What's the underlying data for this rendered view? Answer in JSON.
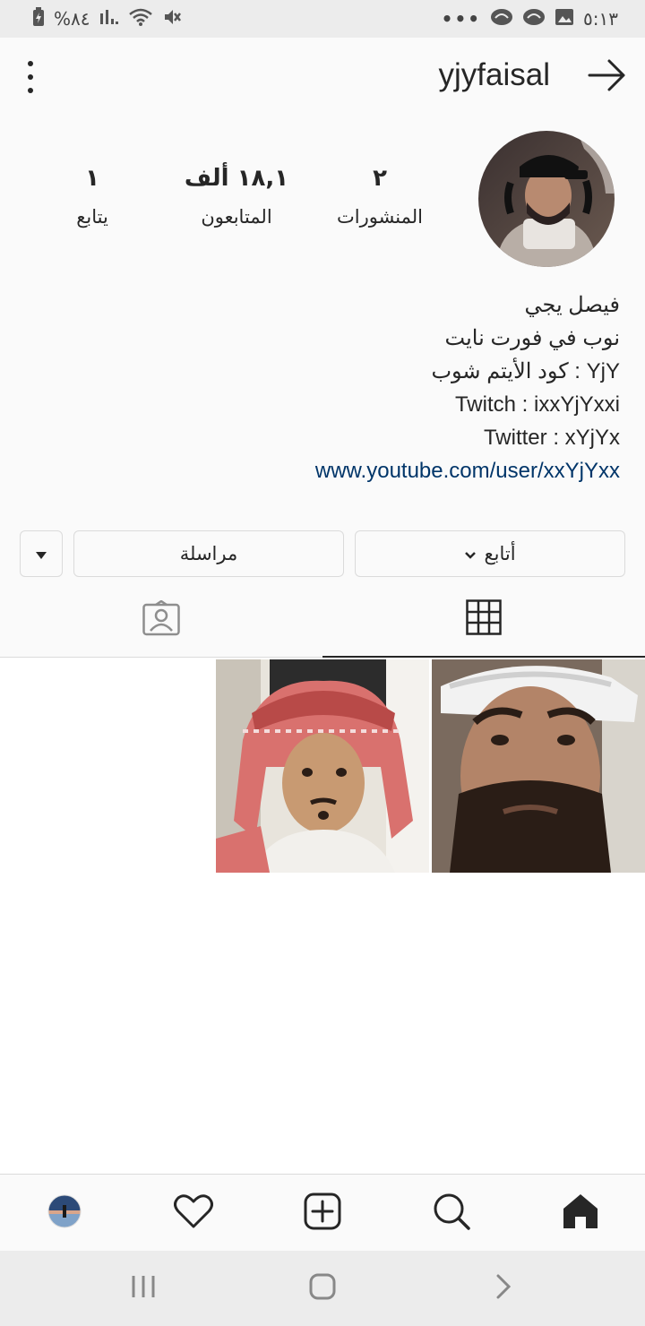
{
  "status_bar": {
    "time": "٥:١٣",
    "battery": "%٨٤",
    "more": "•••"
  },
  "header": {
    "username": "yjyfaisal"
  },
  "profile": {
    "stats": {
      "posts_count": "٢",
      "posts_label": "المنشورات",
      "followers_count": "١٨,١ ألف",
      "followers_label": "المتابعون",
      "following_count": "١",
      "following_label": "يتابع"
    },
    "bio": {
      "name": "فيصل يجي",
      "line1": "نوب في فورت نايت",
      "line2": "كود الأيتم شوب : YjY",
      "line3": "Twitch : ixxYjYxxi",
      "line4": "Twitter : xYjYx",
      "link": "www.youtube.com/user/xxYjYxx"
    }
  },
  "actions": {
    "follow_label": "أتابع",
    "message_label": "مراسلة"
  },
  "colors": {
    "link": "#003569",
    "text": "#262626",
    "border": "#dbdbdb"
  }
}
